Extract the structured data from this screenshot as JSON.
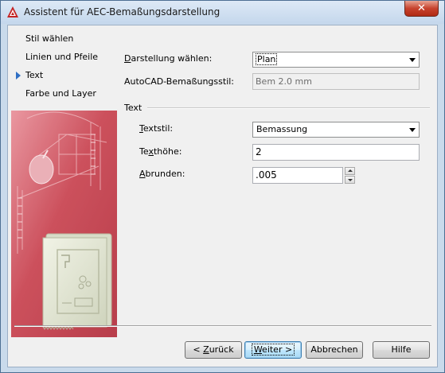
{
  "window": {
    "title": "Assistent für AEC-Bemaßungsdarstellung",
    "close_label": "✕"
  },
  "nav": {
    "items": [
      {
        "label": "Stil wählen",
        "current": false
      },
      {
        "label": "Linien und Pfeile",
        "current": false
      },
      {
        "label": "Text",
        "current": true
      },
      {
        "label": "Farbe und Layer",
        "current": false
      }
    ]
  },
  "form": {
    "darstellung": {
      "label_pre": "",
      "label_key": "D",
      "label_post": "arstellung wählen:",
      "value": "Plan"
    },
    "autocad_stil": {
      "label": "AutoCAD-Bemaßungsstil:",
      "value": "Bem 2.0 mm"
    },
    "group_title": "Text",
    "textstil": {
      "label_pre": "",
      "label_key": "T",
      "label_post": "extstil:",
      "value": "Bemassung"
    },
    "texthoehe": {
      "label_pre": "Te",
      "label_key": "x",
      "label_post": "thöhe:",
      "value": "2"
    },
    "abrunden": {
      "label_pre": "",
      "label_key": "A",
      "label_post": "brunden:",
      "value": ".005"
    }
  },
  "buttons": {
    "back": {
      "pre": "< ",
      "key": "Z",
      "post": "urück"
    },
    "next": {
      "pre": "",
      "key": "W",
      "post": "eiter >"
    },
    "cancel": "Abbrechen",
    "help": "Hilfe"
  },
  "colors": {
    "accent": "#2f6fc4",
    "illustration_red": "#c8424f",
    "title_bg": "#c4d7ec"
  },
  "icons": {
    "app": "autocad-logo-icon",
    "current_step": "triangle-right-icon"
  }
}
